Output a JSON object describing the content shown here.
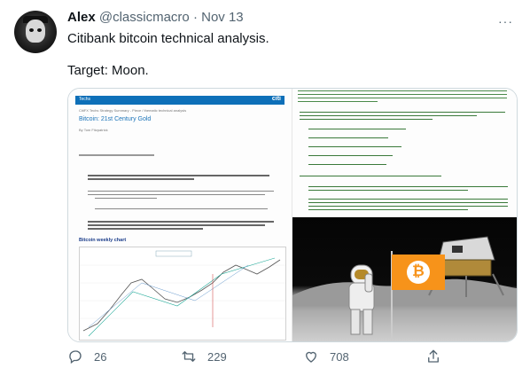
{
  "tweet": {
    "author_name": "Alex",
    "handle": "@classicmacro",
    "separator": "·",
    "date": "Nov 13",
    "more": "···",
    "line1": "Citibank bitcoin technical analysis.",
    "line2": "Target: Moon."
  },
  "media": {
    "doc_header_label": "Techs",
    "doc_header_logo": "citi",
    "doc_small1": "CitiFX Techs Strategy Summary - Piece / thematic technical analysis",
    "doc_title": "Bitcoin: 21st Century Gold",
    "doc_author": "By Tom Fitzpatrick",
    "chart_title": "Bitcoin weekly chart",
    "chart_inner_label": "Blue (RF Points)",
    "flag_symbol": "₿"
  },
  "actions": {
    "reply_count": "26",
    "retweet_count": "229",
    "like_count": "708"
  },
  "colors": {
    "link_blue": "#1d9bf0",
    "muted": "#536471",
    "citi_blue": "#0d6fb8",
    "flag_orange": "#f7931a",
    "doc_green": "#2f7a2f"
  }
}
